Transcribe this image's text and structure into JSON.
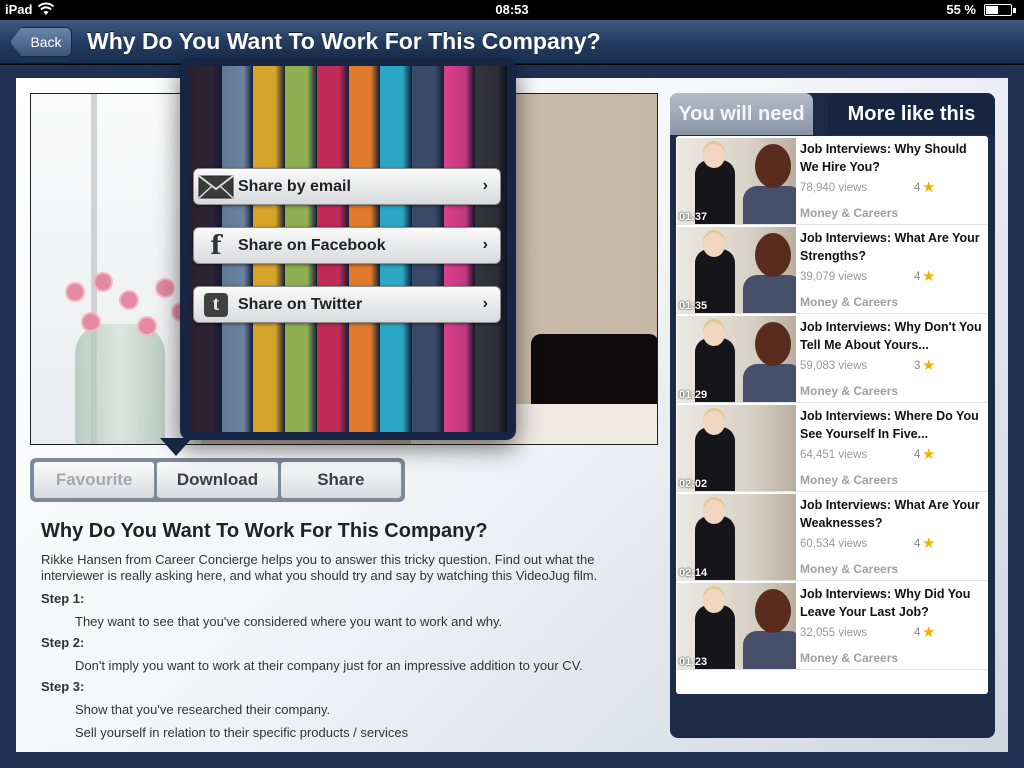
{
  "status_bar": {
    "carrier": "iPad",
    "time": "08:53",
    "battery": "55 %"
  },
  "nav": {
    "back_label": "Back",
    "title": "Why Do You Want To Work For This Company?"
  },
  "actions": {
    "favourite": "Favourite",
    "download": "Download",
    "share": "Share"
  },
  "share_menu": {
    "items": [
      {
        "label": "Share by email",
        "icon": "envelope-icon"
      },
      {
        "label": "Share on Facebook",
        "icon": "facebook-icon"
      },
      {
        "label": "Share on Twitter",
        "icon": "twitter-icon"
      }
    ],
    "stripe_colors": [
      "#3a2a3f",
      "#6f89a8",
      "#d7a42a",
      "#8fae50",
      "#c02a59",
      "#e27a2c",
      "#2ca8c4",
      "#3a4b6a",
      "#de3f8e",
      "#3f3f49"
    ]
  },
  "description": {
    "title": "Why Do You Want To Work For This Company?",
    "intro": "Rikke Hansen from Career Concierge helps you to answer this tricky question.  Find out what the interviewer is really asking here, and what you should try and say by watching this VideoJug film.",
    "steps": [
      {
        "label": "Step 1:",
        "text": "They want to see that you've considered where you want to work and why."
      },
      {
        "label": "Step 2:",
        "text": "Don't imply you want to work at their company just for an impressive addition to your CV."
      },
      {
        "label": "Step 3:",
        "text": "Show that you've researched their company."
      }
    ],
    "cutoff_text": "Sell yourself in relation to their specific products / services"
  },
  "side": {
    "tabs": [
      "You will need",
      "More like this"
    ],
    "items": [
      {
        "title": "Job Interviews: Why Should We Hire You?",
        "views": "78,940 views",
        "rating": "4",
        "category": "Money & Careers",
        "duration": "01:37"
      },
      {
        "title": "Job Interviews: What Are Your Strengths?",
        "views": "39,079 views",
        "rating": "4",
        "category": "Money & Careers",
        "duration": "01:35"
      },
      {
        "title": "Job Interviews: Why Don't You Tell Me About Yours...",
        "views": "59,083 views",
        "rating": "3",
        "category": "Money & Careers",
        "duration": "01:29"
      },
      {
        "title": "Job Interviews: Where Do You See Yourself In Five...",
        "views": "64,451 views",
        "rating": "4",
        "category": "Money & Careers",
        "duration": "02:02"
      },
      {
        "title": "Job Interviews: What Are Your Weaknesses?",
        "views": "60,534 views",
        "rating": "4",
        "category": "Money & Careers",
        "duration": "02:14"
      },
      {
        "title": "Job Interviews: Why Did You Leave Your Last Job?",
        "views": "32,055 views",
        "rating": "4",
        "category": "Money & Careers",
        "duration": "01:23"
      }
    ]
  }
}
